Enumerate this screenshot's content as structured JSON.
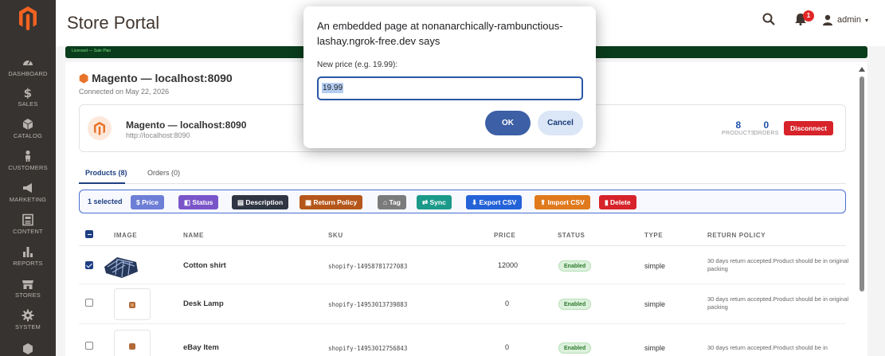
{
  "header": {
    "title": "Store Portal",
    "user": "admin",
    "notification_count": "1"
  },
  "sidebar": {
    "items": [
      {
        "label": "DASHBOARD",
        "icon": "dashboard-icon"
      },
      {
        "label": "SALES",
        "icon": "dollar-icon"
      },
      {
        "label": "CATALOG",
        "icon": "cube-icon"
      },
      {
        "label": "CUSTOMERS",
        "icon": "person-icon"
      },
      {
        "label": "MARKETING",
        "icon": "megaphone-icon"
      },
      {
        "label": "CONTENT",
        "icon": "content-icon"
      },
      {
        "label": "REPORTS",
        "icon": "bar-chart-icon"
      },
      {
        "label": "STORES",
        "icon": "store-icon"
      },
      {
        "label": "SYSTEM",
        "icon": "gear-icon"
      }
    ]
  },
  "greenbar": {
    "text": "Licensed — Sale Plan"
  },
  "connection": {
    "title": "Magento — localhost:8090",
    "subtitle": "Connected on May 22, 2026",
    "card_name": "Magento — localhost:8090",
    "card_url": "http://localhost:8090",
    "products_count": "8",
    "products_label": "PRODUCTS",
    "orders_count": "0",
    "orders_label": "ORDERS",
    "disconnect_label": "Disconnect"
  },
  "tabs": [
    {
      "label": "Products (8)",
      "active": true
    },
    {
      "label": "Orders (0)",
      "active": false
    }
  ],
  "toolbar": {
    "selected": "1 selected",
    "buttons": [
      {
        "label": "Price",
        "color": "#6c7ed6"
      },
      {
        "label": "Status",
        "color": "#7a55c9"
      },
      {
        "label": "Description",
        "color": "#2f3542"
      },
      {
        "label": "Return Policy",
        "color": "#b5571b"
      },
      {
        "label": "Tag",
        "color": "#7b7b7b"
      },
      {
        "label": "Sync",
        "color": "#1b9a8a"
      },
      {
        "label": "Export CSV",
        "color": "#2462d8"
      },
      {
        "label": "Import CSV",
        "color": "#e07a1c"
      },
      {
        "label": "Delete",
        "color": "#d7232a"
      }
    ]
  },
  "table": {
    "columns": [
      "IMAGE",
      "NAME",
      "SKU",
      "PRICE",
      "STATUS",
      "TYPE",
      "RETURN POLICY"
    ],
    "rows": [
      {
        "checked": true,
        "name": "Cotton shirt",
        "sku": "shopify-14958781727083",
        "price": "12000",
        "status": "Enabled",
        "type": "simple",
        "policy": "30 days return accepted.Product should be in original packing"
      },
      {
        "checked": false,
        "name": "Desk Lamp",
        "sku": "shopify-14953013739883",
        "price": "0",
        "status": "Enabled",
        "type": "simple",
        "policy": "30 days return accepted.Product should be in original packing"
      },
      {
        "checked": false,
        "name": "eBay Item",
        "sku": "shopify-14953012756843",
        "price": "0",
        "status": "Enabled",
        "type": "simple",
        "policy": "30 days return accepted.Product should be in"
      }
    ]
  },
  "dialog": {
    "title": "An embedded page at nonanarchically-rambunctious-lashay.ngrok-free.dev says",
    "message": "New price (e.g. 19.99):",
    "input_value": "19.99",
    "ok_label": "OK",
    "cancel_label": "Cancel"
  }
}
